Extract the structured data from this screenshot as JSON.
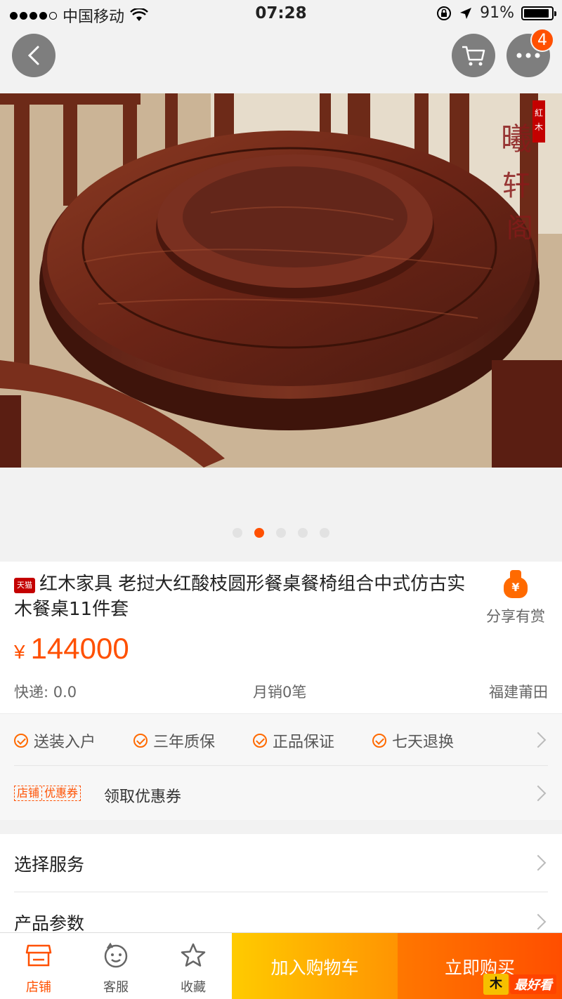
{
  "status_bar": {
    "carrier": "中国移动",
    "time": "07:28",
    "battery": "91%",
    "battery_level": 0.91
  },
  "nav": {
    "more_badge": "4"
  },
  "hero": {
    "slide_count": 5,
    "active_slide": 2
  },
  "product": {
    "shop_tag": "天猫",
    "title": "红木家具 老挝大红酸枝圆形餐桌餐椅组合中式仿古实木餐桌11件套",
    "share_icon_glyph": "¥",
    "share_label": "分享有赏",
    "currency": "¥",
    "price": "144000",
    "express": "快递: 0.0",
    "monthly_sales": "月销0笔",
    "location": "福建莆田"
  },
  "services": {
    "items": [
      "送装入户",
      "三年质保",
      "正品保证",
      "七天退换"
    ],
    "coupon_tag_left": "店铺",
    "coupon_tag_right": "优惠券",
    "coupon_text": "领取优惠券"
  },
  "options": {
    "select_service": "选择服务",
    "product_params": "产品参数"
  },
  "bottom_bar": {
    "shop": "店铺",
    "customer_service": "客服",
    "favorite": "收藏",
    "add_to_cart": "加入购物车",
    "buy_now": "立即购买",
    "watermark_glyph": "木",
    "watermark": "最好看"
  },
  "colors": {
    "accent": "#ff5000",
    "cart_button": "#ffa200",
    "buy_button": "#ff5a00"
  }
}
